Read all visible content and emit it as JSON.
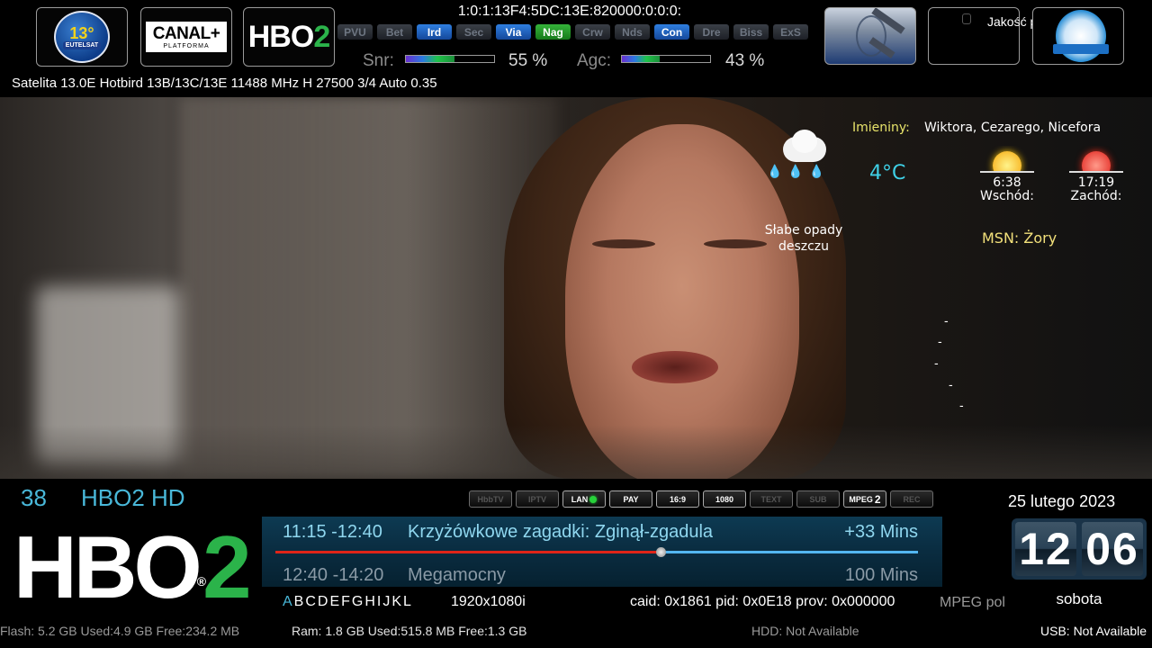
{
  "top": {
    "service_ref": "1:0:1:13F4:5DC:13E:820000:0:0:0:",
    "cas_systems": [
      {
        "label": "PVU",
        "state": "off"
      },
      {
        "label": "Bet",
        "state": "off"
      },
      {
        "label": "Ird",
        "state": "blue"
      },
      {
        "label": "Sec",
        "state": "off"
      },
      {
        "label": "Via",
        "state": "blue"
      },
      {
        "label": "Nag",
        "state": "green"
      },
      {
        "label": "Crw",
        "state": "off"
      },
      {
        "label": "Nds",
        "state": "off"
      },
      {
        "label": "Con",
        "state": "blue"
      },
      {
        "label": "Dre",
        "state": "off"
      },
      {
        "label": "Biss",
        "state": "off"
      },
      {
        "label": "ExS",
        "state": "off"
      }
    ],
    "snr_label": "Snr:",
    "snr_value": "55 %",
    "snr_percent": 55,
    "agc_label": "Agc:",
    "agc_value": "43 %",
    "agc_percent": 43,
    "satellite_info": "Satelita 13.0E Hotbird 13B/13C/13E 11488 MHz H 27500 3/4  Auto 0.35",
    "quality_text": "Jakość powie",
    "logos": {
      "eutelsat_text": "EUTELSAT",
      "eutelsat_num": "13°",
      "canal_main": "CANAL+",
      "canal_sub": "PLATFORMA",
      "hbo_logo": "HBO",
      "hbo_logo_num": "2"
    }
  },
  "weather": {
    "names_label": "Imieniny:",
    "names_value": "Wiktora, Cezarego, Nicefora",
    "temperature": "4°C",
    "description_line1": "Słabe opady",
    "description_line2": "deszczu",
    "sunrise_time": "6:38",
    "sunrise_label": "Wschód:",
    "sunset_time": "17:19",
    "sunset_label": "Zachód:",
    "location": "MSN: Żory",
    "icon": "cloud-rain-icon"
  },
  "channel": {
    "number": "38",
    "name": "HBO2 HD",
    "logo_text": "HBO",
    "logo_num": "2",
    "logo_reg": "®"
  },
  "flags": [
    {
      "label": "HbbTV",
      "on": false
    },
    {
      "label": "IPTV",
      "on": false
    },
    {
      "label": "LAN",
      "on": true,
      "led": "green"
    },
    {
      "label": "PAY",
      "on": true
    },
    {
      "label": "16:9",
      "on": true
    },
    {
      "label": "1080",
      "on": true
    },
    {
      "label": "TEXT",
      "on": false
    },
    {
      "label": "SUB",
      "on": false
    },
    {
      "label": "MPEG",
      "on": true,
      "num": "2"
    },
    {
      "label": "REC",
      "on": false
    }
  ],
  "epg": {
    "now_time": "11:15 -12:40",
    "now_title": "Krzyżówkowe zagadki: Zginął-zgadula",
    "now_remaining": "+33 Mins",
    "progress_percent": 60,
    "next_time": "12:40 -14:20",
    "next_title": "Megamocny",
    "next_duration": "100 Mins"
  },
  "info_row": {
    "letters_first": "A",
    "letters_rest": "BCDEFGHIJKL",
    "resolution": "1920x1080i",
    "caid": "caid: 0x1861  pid: 0x0E18  prov: 0x000000",
    "codec": "MPEG pol"
  },
  "datetime": {
    "date": "25 lutego 2023",
    "hour": "12",
    "minute": "06",
    "weekday": "sobota"
  },
  "footer": {
    "flash": "Flash: 5.2 GB Used:4.9 GB Free:234.2 MB",
    "ram": "Ram: 1.8 GB Used:515.8 MB Free:1.3 GB",
    "hdd": "HDD: Not Available",
    "usb": "USB: Not Available"
  }
}
